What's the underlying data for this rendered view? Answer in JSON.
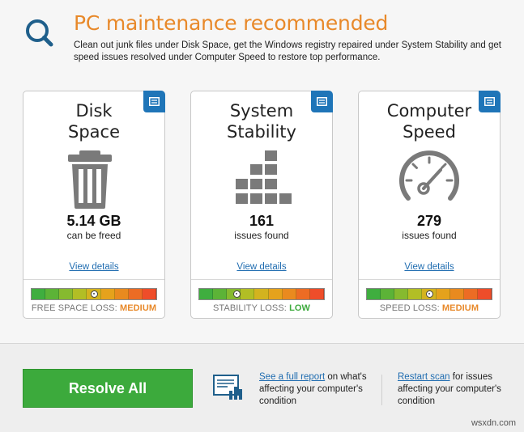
{
  "header": {
    "title": "PC maintenance recommended",
    "subtitle": "Clean out junk files under Disk Space, get the Windows registry repaired under System Stability and get speed issues resolved under Computer Speed to restore top performance.",
    "icon": "magnifier-icon",
    "accent_color": "#e8892a"
  },
  "cards": [
    {
      "title_line1": "Disk",
      "title_line2": "Space",
      "icon": "trash-icon",
      "value": "5.14 GB",
      "caption": "can be freed",
      "link": "View details",
      "loss_label": "FREE SPACE LOSS:",
      "loss_level": "MEDIUM",
      "loss_color": "#e8892a",
      "meter_position": 0.5
    },
    {
      "title_line1": "System",
      "title_line2": "Stability",
      "icon": "registry-blocks-icon",
      "value": "161",
      "caption": "issues found",
      "link": "View details",
      "loss_label": "STABILITY LOSS:",
      "loss_level": "LOW",
      "loss_color": "#3caa3c",
      "meter_position": 0.3
    },
    {
      "title_line1": "Computer",
      "title_line2": "Speed",
      "icon": "speedometer-icon",
      "value": "279",
      "caption": "issues found",
      "link": "View details",
      "loss_label": "SPEED LOSS:",
      "loss_level": "MEDIUM",
      "loss_color": "#e8892a",
      "meter_position": 0.5
    }
  ],
  "footer": {
    "resolve_label": "Resolve All",
    "report_link": "See a full report",
    "report_text": " on what's affecting your computer's condition",
    "restart_link": "Restart scan",
    "restart_text": " for issues affecting your computer's condition",
    "button_color": "#3caa3c"
  },
  "watermark": "wsxdn.com"
}
